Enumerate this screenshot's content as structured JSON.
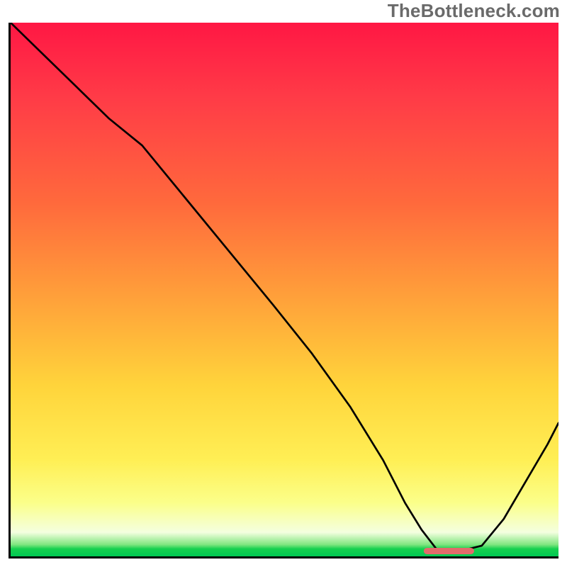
{
  "watermark": "TheBottleneck.com",
  "chart_data": {
    "type": "line",
    "title": "",
    "xlabel": "",
    "ylabel": "",
    "xlim": [
      0,
      100
    ],
    "ylim": [
      0,
      100
    ],
    "grid": false,
    "legend": false,
    "gradient_background": {
      "orientation": "vertical",
      "stops": [
        {
          "pos": 0.0,
          "color": "#ff1744"
        },
        {
          "pos": 0.14,
          "color": "#ff3b47"
        },
        {
          "pos": 0.34,
          "color": "#ff6a3c"
        },
        {
          "pos": 0.52,
          "color": "#ffa23a"
        },
        {
          "pos": 0.68,
          "color": "#ffd43b"
        },
        {
          "pos": 0.82,
          "color": "#ffef55"
        },
        {
          "pos": 0.9,
          "color": "#fbff8a"
        },
        {
          "pos": 0.955,
          "color": "#f4ffe0"
        },
        {
          "pos": 0.978,
          "color": "#7fe67f"
        },
        {
          "pos": 0.986,
          "color": "#16d04e"
        },
        {
          "pos": 1.0,
          "color": "#00c853"
        }
      ]
    },
    "series": [
      {
        "name": "bottleneck-curve",
        "color": "#000000",
        "x": [
          0,
          6,
          12,
          18,
          24,
          32,
          40,
          48,
          55,
          62,
          68,
          72,
          75,
          78,
          82,
          86,
          90,
          94,
          98,
          100
        ],
        "values": [
          100,
          94,
          88,
          82,
          77,
          67,
          57,
          47,
          38,
          28,
          18,
          10,
          5,
          1,
          1,
          2,
          7,
          14,
          21,
          25
        ]
      },
      {
        "name": "optimal-marker",
        "type": "segment",
        "color": "#e26b6b",
        "x": [
          76,
          84
        ],
        "values": [
          1,
          1
        ]
      }
    ],
    "annotations": {
      "marker_note": "short pink horizontal segment near curve minimum"
    }
  }
}
